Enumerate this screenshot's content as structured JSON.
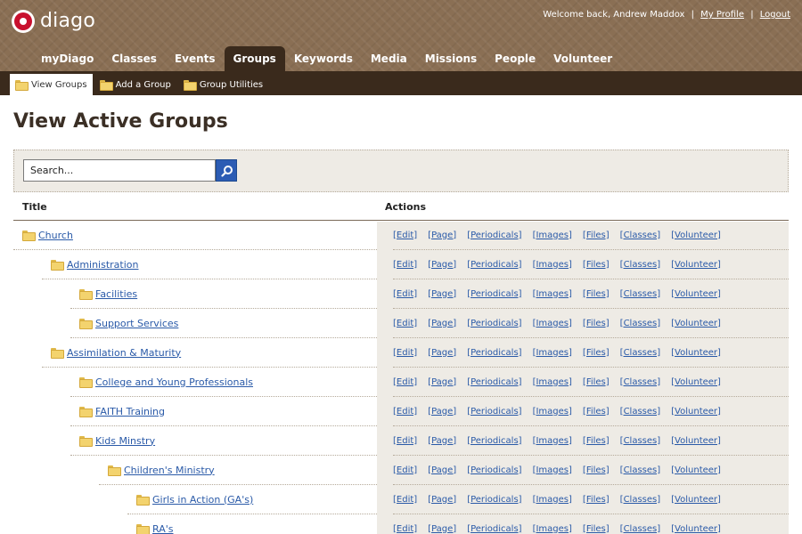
{
  "brand": {
    "name": "diago"
  },
  "header": {
    "welcome_text": "Welcome back, Andrew Maddox",
    "separator": "|",
    "my_profile": "My Profile",
    "logout": "Logout"
  },
  "main_nav": [
    {
      "label": "myDiago"
    },
    {
      "label": "Classes"
    },
    {
      "label": "Events"
    },
    {
      "label": "Groups",
      "active": true
    },
    {
      "label": "Keywords"
    },
    {
      "label": "Media"
    },
    {
      "label": "Missions"
    },
    {
      "label": "People"
    },
    {
      "label": "Volunteer"
    }
  ],
  "sub_nav": [
    {
      "label": "View Groups",
      "active": true,
      "icon": "folder-icon"
    },
    {
      "label": "Add a Group",
      "icon": "folder-add-icon"
    },
    {
      "label": "Group Utilities",
      "icon": "folder-tools-icon"
    }
  ],
  "page": {
    "title": "View Active Groups"
  },
  "search": {
    "placeholder": "Search...",
    "button_icon": "search-icon"
  },
  "table": {
    "col_title": "Title",
    "col_actions": "Actions",
    "action_labels": [
      "[Edit]",
      "[Page]",
      "[Periodicals]",
      "[Images]",
      "[Files]",
      "[Classes]",
      "[Volunteer]"
    ],
    "rows": [
      {
        "title": "Church",
        "level": 0
      },
      {
        "title": "Administration",
        "level": 1
      },
      {
        "title": "Facilities",
        "level": 2
      },
      {
        "title": "Support Services",
        "level": 2
      },
      {
        "title": "Assimilation & Maturity",
        "level": 1
      },
      {
        "title": "College and Young Professionals",
        "level": 2
      },
      {
        "title": "FAITH Training",
        "level": 2
      },
      {
        "title": "Kids Minstry",
        "level": 2
      },
      {
        "title": "Children's Ministry",
        "level": 3
      },
      {
        "title": "Girls in Action (GA's)",
        "level": 4
      },
      {
        "title": "RA's",
        "level": 4
      }
    ]
  },
  "colors": {
    "header": "#8a6f54",
    "subnav": "#3a2a1c",
    "link": "#2a5aa8",
    "panel": "#eeebe5",
    "logo_red": "#c8102e"
  }
}
